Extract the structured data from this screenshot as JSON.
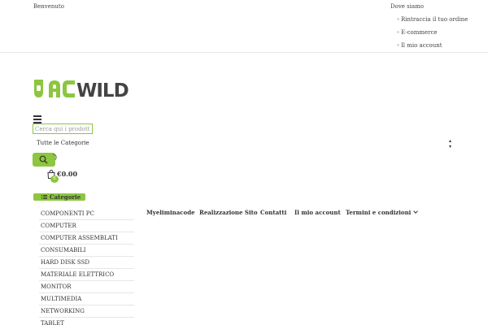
{
  "topbar": {
    "welcome": "Benvenuto",
    "links": [
      "Dove siamo",
      "Rintraccia il tuo ordine",
      "E-commerce",
      "Il mio account"
    ]
  },
  "logo": {
    "text": "ACWILD",
    "icon": "acwild-logo"
  },
  "search": {
    "placeholder": "Cerca qui i prodotti",
    "category_selected": "Tutte le Categorie",
    "button_icon": "search-icon"
  },
  "cart": {
    "count": "0",
    "amount": "€0.00",
    "icon": "shopping-bag-icon"
  },
  "categories": {
    "title": "Categorie",
    "items": [
      "COMPONENTI PC",
      "COMPUTER",
      "COMPUTER ASSEMBLATI",
      "CONSUMABILI",
      "HARD DISK SSD",
      "MATERIALE ELETTRICO",
      "MONITOR",
      "MULTIMEDIA",
      "NETWORKING",
      "TABLET"
    ]
  },
  "nav": {
    "items": [
      "Myeliminacode",
      "Realizzazione Sito",
      "Contatti",
      "Il mio account",
      "Termini e condizioni"
    ]
  },
  "colors": {
    "accent": "#8dc63f",
    "logo_dark": "#444444"
  }
}
